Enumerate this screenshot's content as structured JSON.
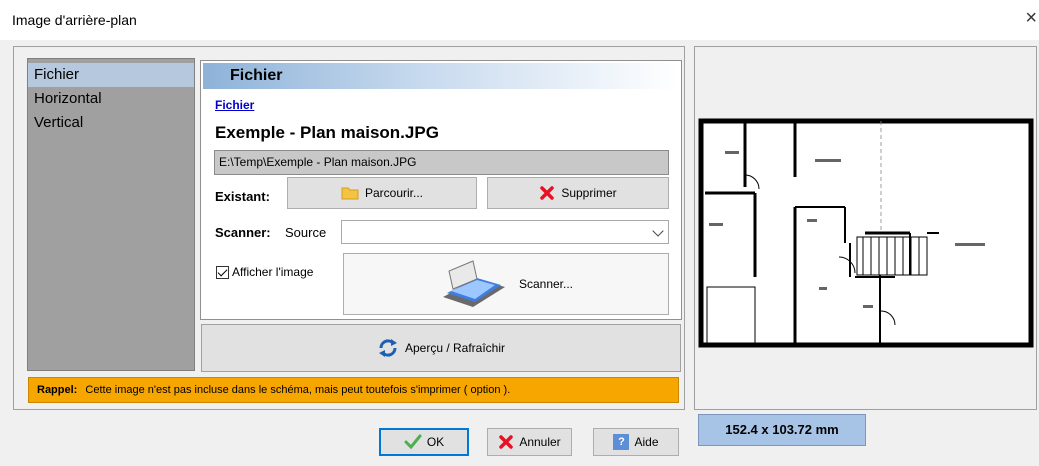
{
  "window": {
    "title": "Image d'arrière-plan",
    "close_glyph": "×"
  },
  "sidebar": {
    "items": [
      {
        "label": "Fichier",
        "selected": true
      },
      {
        "label": "Horizontal",
        "selected": false
      },
      {
        "label": "Vertical",
        "selected": false
      }
    ]
  },
  "panel": {
    "header": "Fichier",
    "file_link": "Fichier",
    "file_name": "Exemple - Plan maison.JPG",
    "file_path": "E:\\Temp\\Exemple - Plan maison.JPG",
    "existant_label": "Existant:",
    "browse_label": "Parcourir...",
    "delete_label": "Supprimer",
    "scanner_label": "Scanner:",
    "source_label": "Source",
    "source_value": "",
    "show_image_label": "Afficher l'image",
    "show_image_checked": true,
    "scan_button_label": "Scanner..."
  },
  "refresh_label": "Aperçu / Rafraîchir",
  "reminder": {
    "prefix": "Rappel:",
    "text": "Cette image n'est pas incluse dans le schéma, mais peut toutefois s'imprimer ( option )."
  },
  "preview": {
    "dimensions": "152.4 x 103.72 mm"
  },
  "buttons": {
    "ok": "OK",
    "cancel": "Annuler",
    "help": "Aide"
  },
  "colors": {
    "accent_orange": "#f7a600",
    "selection_blue": "#b6c8de",
    "dims_blue": "#a7c3e5",
    "delete_red": "#e81123",
    "ok_green": "#4caf50"
  }
}
